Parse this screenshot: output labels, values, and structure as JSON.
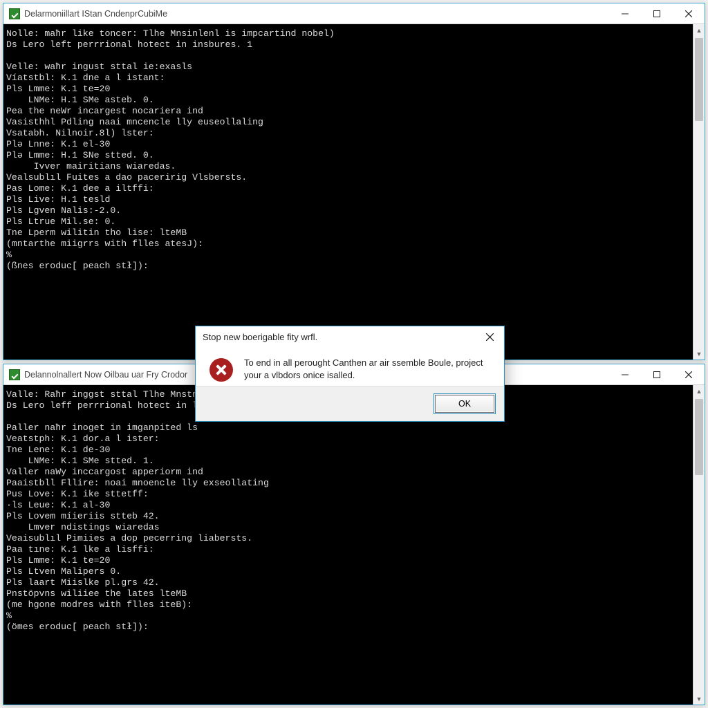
{
  "window_top": {
    "title": "Delarmoniillart IStan CndenprCubiMe",
    "lines": [
      "Nolle: maħr like toncer: Tlhe Mnsinlenl is impcartind nobel)",
      "Ds Lero left perrrional hotect in insbures. 1",
      "",
      "Velle: waħr ingust sttal ie:exasls",
      "Víatstbl: K.1 dne a l istant:",
      "Pls Lmme: K.1 te=20",
      "    LNMe: H.1 SMe asteb. 0.",
      "Pea the neWr incargest nocariera ind",
      "Vasisthhl Pdling naai mncencle lly euseollaling",
      "Vsatabh. Nilnoir.8l) lster:",
      "Plə Lnne: K.1 el-30",
      "Plə Lmme: H.1 SNe stted. 0.",
      "     Ivver mairitians wiaredas.",
      "Vealsublıl Fuites a dao paceririg Vlsbersts.",
      "Pas Lome: K.1 dee a iltffi:",
      "Pls Live: H.1 tesld",
      "Pls Lgven Nalis:-2.0.",
      "Pls Ltrue Mil.se: 0.",
      "Tne Lperm wilitin tho lise: lteMB",
      "(mntarthe miigrrs with flles atesJ):",
      "%",
      "(ßnes eroduc[ peach stł]):"
    ]
  },
  "window_bottom": {
    "title": "Delannolnallert Now Oilbau uar Fry Crodor",
    "lines": [
      "Valle: Raħr inggst sttal Tlhe Mnstno",
      "Ds Lero leff perrrional hotect in lty",
      "",
      "Paller naħr inoget in imganpited ls",
      "Veatstph: K.1 dor.a l ister:",
      "Tne Lene: K.1 de-30",
      "    LNMe: K.1 SMe stted. 1.",
      "Valler naWy inccargost apperiorm ind",
      "Paaistbll Fllire: noai mnoencle lly exseollating",
      "Pus Love: K.1 ike sttetff:",
      "·ls Leue: K.1 al-30",
      "Pls Lovem míieriis stteb 42.",
      "    Lmver ndistings wiaredas",
      "Veaisublıl Pimiies a dop pecerring liabersts.",
      "Paa tıne: K.1 lke a lisffi:",
      "Pls Lmme: K.1 te=20",
      "Pls Ltven Malipers 0.",
      "Pls laart Miislke pl.grs 42.",
      "Pnstöpvns wiliiee the lates lteMB",
      "(me hgone modres with flles iteB):",
      "%",
      "(ömes eroduc[ peach stł]):"
    ]
  },
  "dialog": {
    "title": "Stop new boerigable fity wrfl.",
    "message": "To end in all perought Canthen ar air ssemble Boule, project your a vlbdors onice isalled.",
    "ok_label": "OK"
  }
}
